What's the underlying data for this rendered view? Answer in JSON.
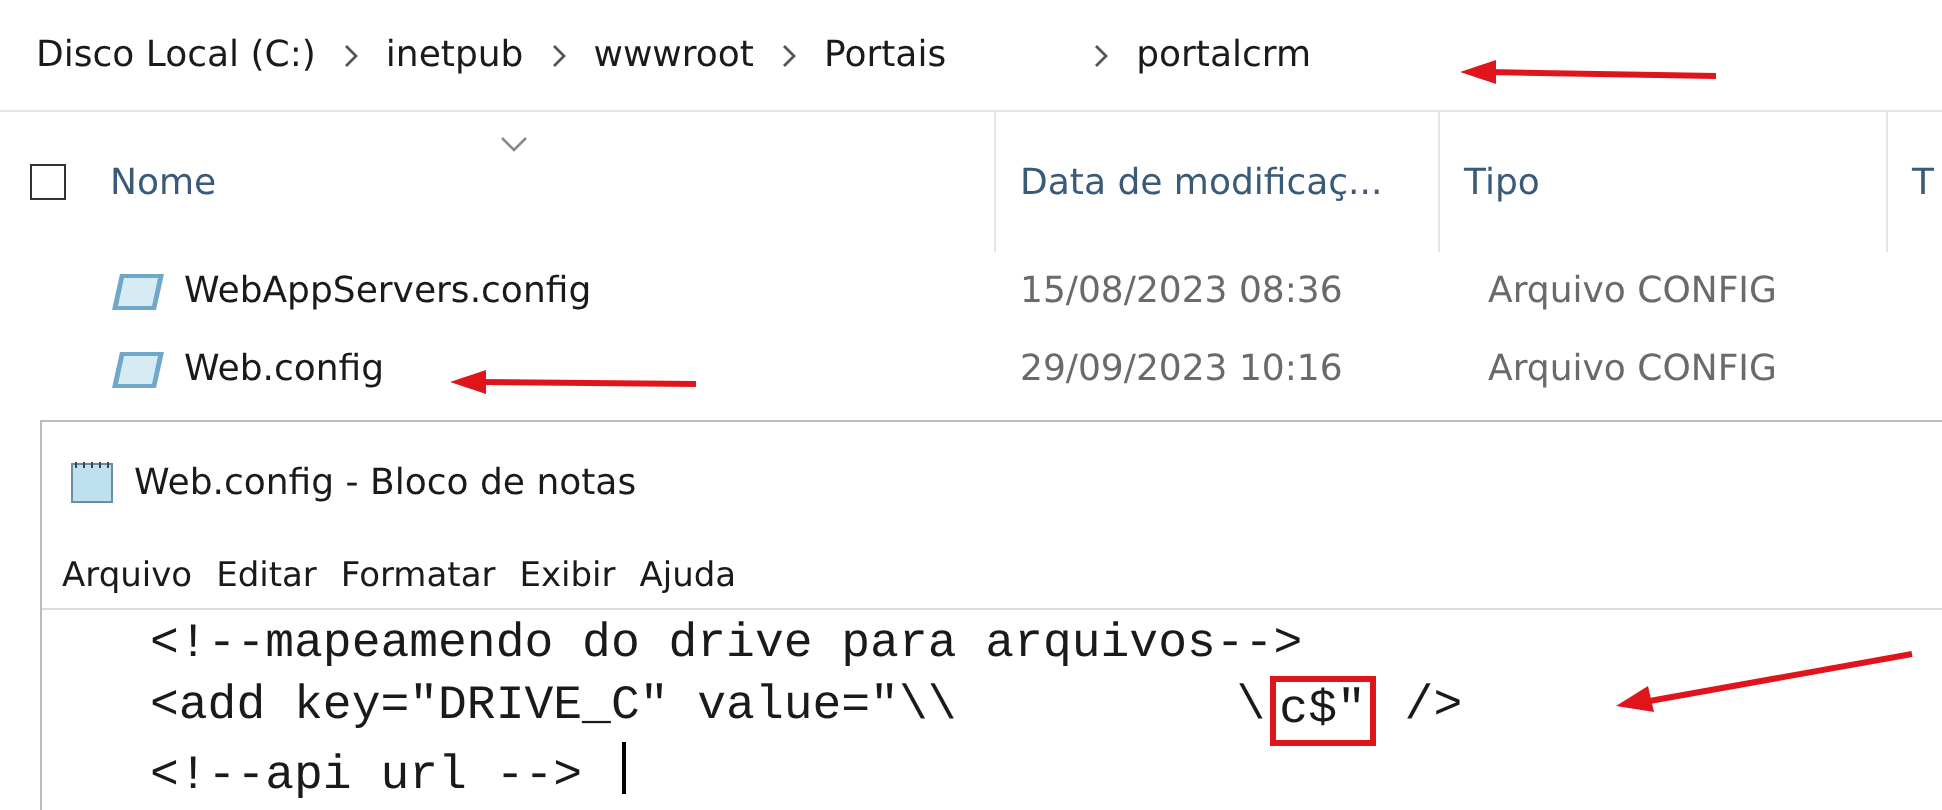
{
  "select_all": {
    "checked": false
  },
  "breadcrumb": [
    "Disco Local (C:)",
    "inetpub",
    "wwwroot",
    "Portais",
    "portalcrm"
  ],
  "columns": [
    {
      "label": "Nome"
    },
    {
      "label": "Data de modificaç..."
    },
    {
      "label": "Tipo"
    },
    {
      "label": "T"
    }
  ],
  "files": [
    {
      "name": "WebAppServers.config",
      "modified": "15/08/2023 08:36",
      "type": "Arquivo CONFIG"
    },
    {
      "name": "Web.config",
      "modified": "29/09/2023 10:16",
      "type": "Arquivo CONFIG"
    }
  ],
  "notepad": {
    "title": "Web.config - Bloco de notas",
    "menu": [
      "Arquivo",
      "Editar",
      "Formatar",
      "Exibir",
      "Ajuda"
    ],
    "lines": [
      {
        "kind": "plain",
        "text": "<!--mapeamendo do drive para arquivos-->"
      },
      {
        "kind": "redacted",
        "before": "<add key=\"DRIVE_C\" value=\"\\\\",
        "after_prefix": "\\",
        "highlight": "c$\"",
        "after": " />"
      },
      {
        "kind": "plain",
        "text": "<!--api url -->"
      }
    ]
  }
}
